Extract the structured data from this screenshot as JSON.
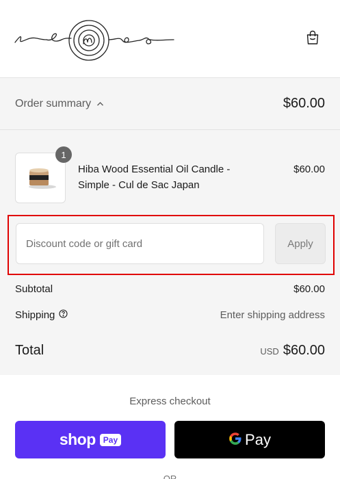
{
  "header": {
    "logo_alt": "remoo",
    "cart_icon": "shopping-bag-icon"
  },
  "summary": {
    "toggle_label": "Order summary",
    "toggle_icon": "chevron-up-icon",
    "total": "$60.00",
    "items": [
      {
        "name": "Hiba Wood Essential Oil Candle - Simple - Cul de Sac Japan",
        "price": "$60.00",
        "quantity": "1"
      }
    ],
    "discount": {
      "placeholder": "Discount code or gift card",
      "value": "",
      "apply_label": "Apply"
    },
    "subtotal_label": "Subtotal",
    "subtotal_value": "$60.00",
    "shipping_label": "Shipping",
    "shipping_icon": "help-circle-icon",
    "shipping_value": "Enter shipping address",
    "total_label": "Total",
    "currency": "USD",
    "total_value": "$60.00"
  },
  "express": {
    "title": "Express checkout",
    "shop_pay_word": "shop",
    "shop_pay_pill": "Pay",
    "gpay_g": "G",
    "gpay_word": "Pay",
    "or_text": "OR"
  },
  "colors": {
    "shop_pay": "#5a31f4",
    "gpay": "#000000",
    "summary_bg": "#f5f5f5",
    "highlight": "#e00000"
  }
}
